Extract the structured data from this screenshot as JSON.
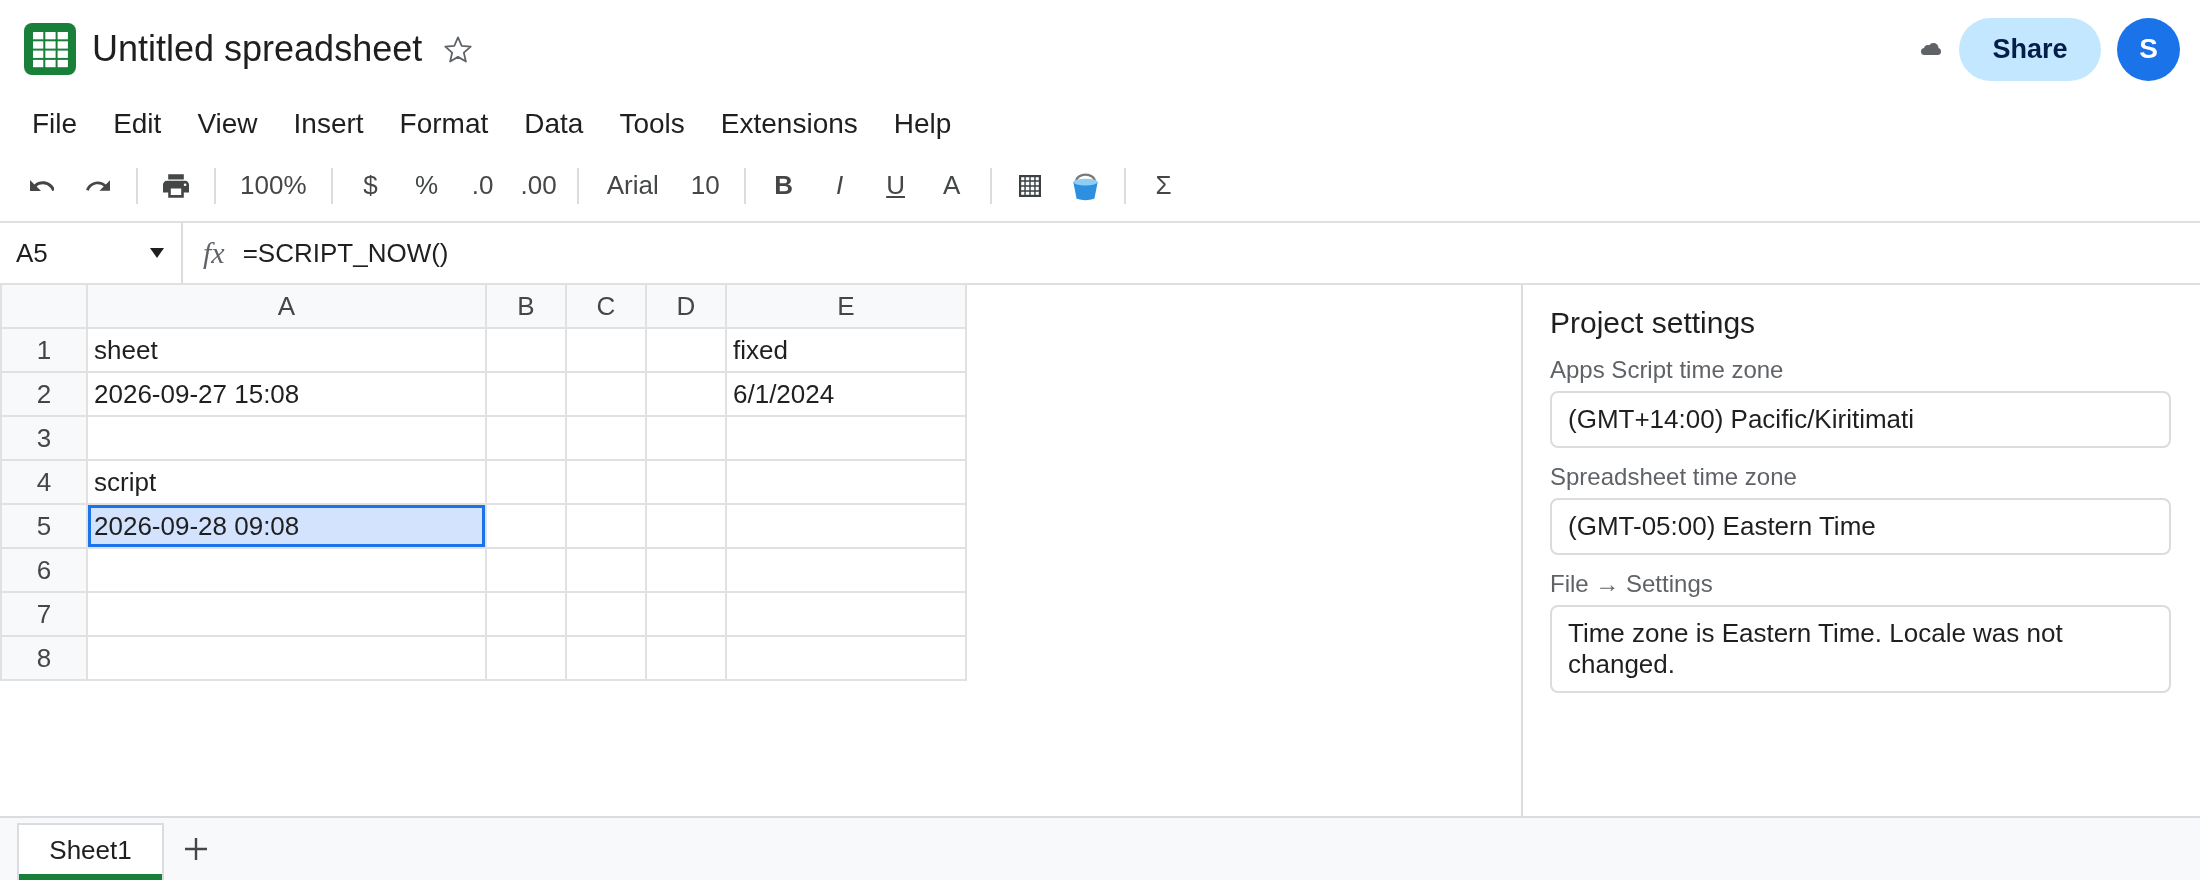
{
  "header": {
    "title": "Untitled spreadsheet",
    "share": "Share",
    "avatar": "S"
  },
  "menu": [
    "File",
    "Edit",
    "View",
    "Insert",
    "Format",
    "Data",
    "Tools",
    "Extensions",
    "Help"
  ],
  "toolbar": {
    "zoom": "100%",
    "number_formats": [
      "$",
      "%",
      ".0",
      ".00"
    ],
    "font": "Arial",
    "font_size": "10",
    "text_formats": [
      {
        "label": "B",
        "kind": "bold"
      },
      {
        "label": "I",
        "kind": "italic"
      },
      {
        "label": "U",
        "kind": "underline"
      },
      {
        "label": "A",
        "kind": "color"
      }
    ],
    "functions": "Σ"
  },
  "formula_bar": {
    "cell": "A5",
    "fx": "fx",
    "formula": "=SCRIPT_NOW()"
  },
  "sheet": {
    "columns": [
      "A",
      "B",
      "C",
      "D",
      "E"
    ],
    "rows": [
      {
        "number": "1",
        "cells": [
          {
            "text": "sheet",
            "selected": false
          },
          {
            "selected": false
          },
          {
            "selected": false
          },
          {
            "selected": false
          },
          {
            "text": "fixed",
            "selected": false
          }
        ]
      },
      {
        "number": "2",
        "cells": [
          {
            "text": "2026-09-27 15:08",
            "selected": false
          },
          {
            "selected": false
          },
          {
            "selected": false
          },
          {
            "selected": false
          },
          {
            "text": "6/1/2024",
            "selected": false
          }
        ]
      },
      {
        "number": "3",
        "cells": [
          {
            "selected": false
          },
          {
            "selected": false
          },
          {
            "selected": false
          },
          {
            "selected": false
          },
          {
            "selected": false
          }
        ]
      },
      {
        "number": "4",
        "cells": [
          {
            "text": "script",
            "selected": false
          },
          {
            "selected": false
          },
          {
            "selected": false
          },
          {
            "selected": false
          },
          {
            "selected": false
          }
        ]
      },
      {
        "number": "5",
        "cells": [
          {
            "text": "2026-09-28 09:08",
            "selected": true
          },
          {
            "selected": false
          },
          {
            "selected": false
          },
          {
            "selected": false
          },
          {
            "selected": false
          }
        ]
      },
      {
        "number": "6",
        "cells": [
          {
            "selected": false
          },
          {
            "selected": false
          },
          {
            "selected": false
          },
          {
            "selected": false
          },
          {
            "selected": false
          }
        ]
      },
      {
        "number": "7",
        "cells": [
          {
            "selected": false
          },
          {
            "selected": false
          },
          {
            "selected": false
          },
          {
            "selected": false
          },
          {
            "selected": false
          }
        ]
      },
      {
        "number": "8",
        "cells": [
          {
            "selected": false
          },
          {
            "selected": false
          },
          {
            "selected": false
          },
          {
            "selected": false
          },
          {
            "selected": false
          }
        ]
      }
    ]
  },
  "settings_panel": {
    "title": "Project settings",
    "fields": [
      {
        "label": "Apps Script time zone",
        "value": "(GMT+14:00) Pacific/Kiritimati"
      },
      {
        "label": "Spreadsheet time zone",
        "value": "(GMT-05:00) Eastern Time"
      },
      {
        "label": "File → Settings",
        "value": "Time zone is Eastern Time. Locale was not changed."
      }
    ]
  },
  "sheet_tabs": [
    {
      "label": "Sheet1",
      "selected": true
    }
  ]
}
